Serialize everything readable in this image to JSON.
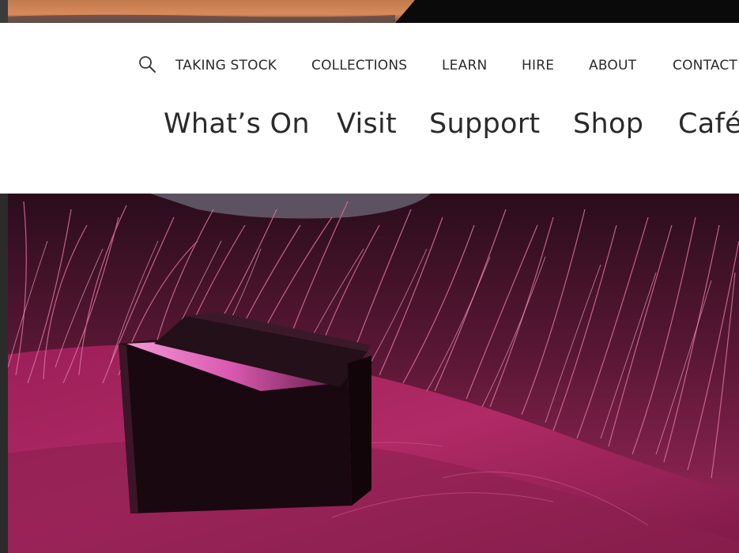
{
  "secondary_nav": {
    "items": [
      {
        "label": "TAKING STOCK"
      },
      {
        "label": "COLLECTIONS"
      },
      {
        "label": "LEARN"
      },
      {
        "label": "HIRE"
      },
      {
        "label": "ABOUT"
      },
      {
        "label": "CONTACT"
      }
    ]
  },
  "primary_nav": {
    "items": [
      {
        "label": "What’s On"
      },
      {
        "label": "Visit"
      },
      {
        "label": "Support"
      },
      {
        "label": "Shop"
      },
      {
        "label": "Café"
      }
    ]
  },
  "colors": {
    "nav_text": "#2b2b2b",
    "header_bg": "#ffffff",
    "hero_tint": "#c2185b"
  },
  "icons": {
    "search": "search-icon"
  }
}
